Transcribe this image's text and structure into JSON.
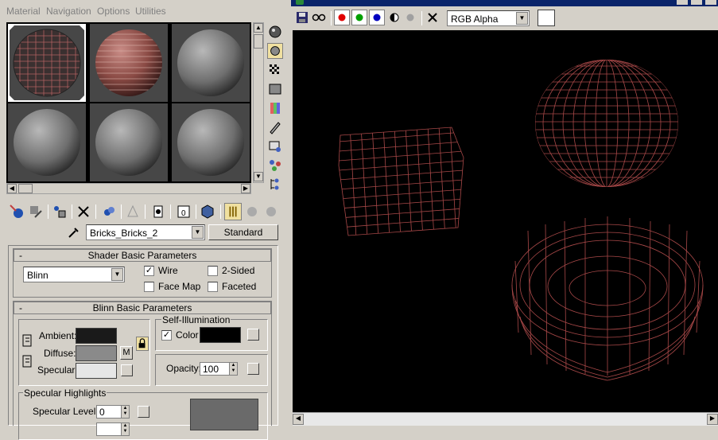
{
  "menu": {
    "material": "Material",
    "navigation": "Navigation",
    "options": "Options",
    "utilities": "Utilities"
  },
  "material_name": "Bricks_Bricks_2",
  "material_type": "Standard",
  "shader_rollout": {
    "title": "Shader Basic Parameters",
    "collapse": "-",
    "shader": "Blinn",
    "wire_label": "Wire",
    "wire_checked": "✓",
    "two_sided_label": "2-Sided",
    "face_map_label": "Face Map",
    "faceted_label": "Faceted"
  },
  "blinn_rollout": {
    "title": "Blinn Basic Parameters",
    "collapse": "-",
    "ambient_label": "Ambient:",
    "diffuse_label": "Diffuse:",
    "specular_label": "Specular:",
    "map_button": "M",
    "self_illum_title": "Self-Illumination",
    "color_label": "Color",
    "color_checked": "✓",
    "opacity_label": "Opacity:",
    "opacity_value": "100",
    "specular_highlights_title": "Specular Highlights",
    "specular_level_label": "Specular Level:",
    "specular_level_value": "0"
  },
  "viewport": {
    "channel": "RGB Alpha"
  },
  "colors": {
    "ambient": "#1a1a1a",
    "diffuse": "#8a8a8a",
    "specular": "#e6e6e6",
    "self_illum": "#000000",
    "wire": "#c46060",
    "viewport_bg": "#000000"
  }
}
